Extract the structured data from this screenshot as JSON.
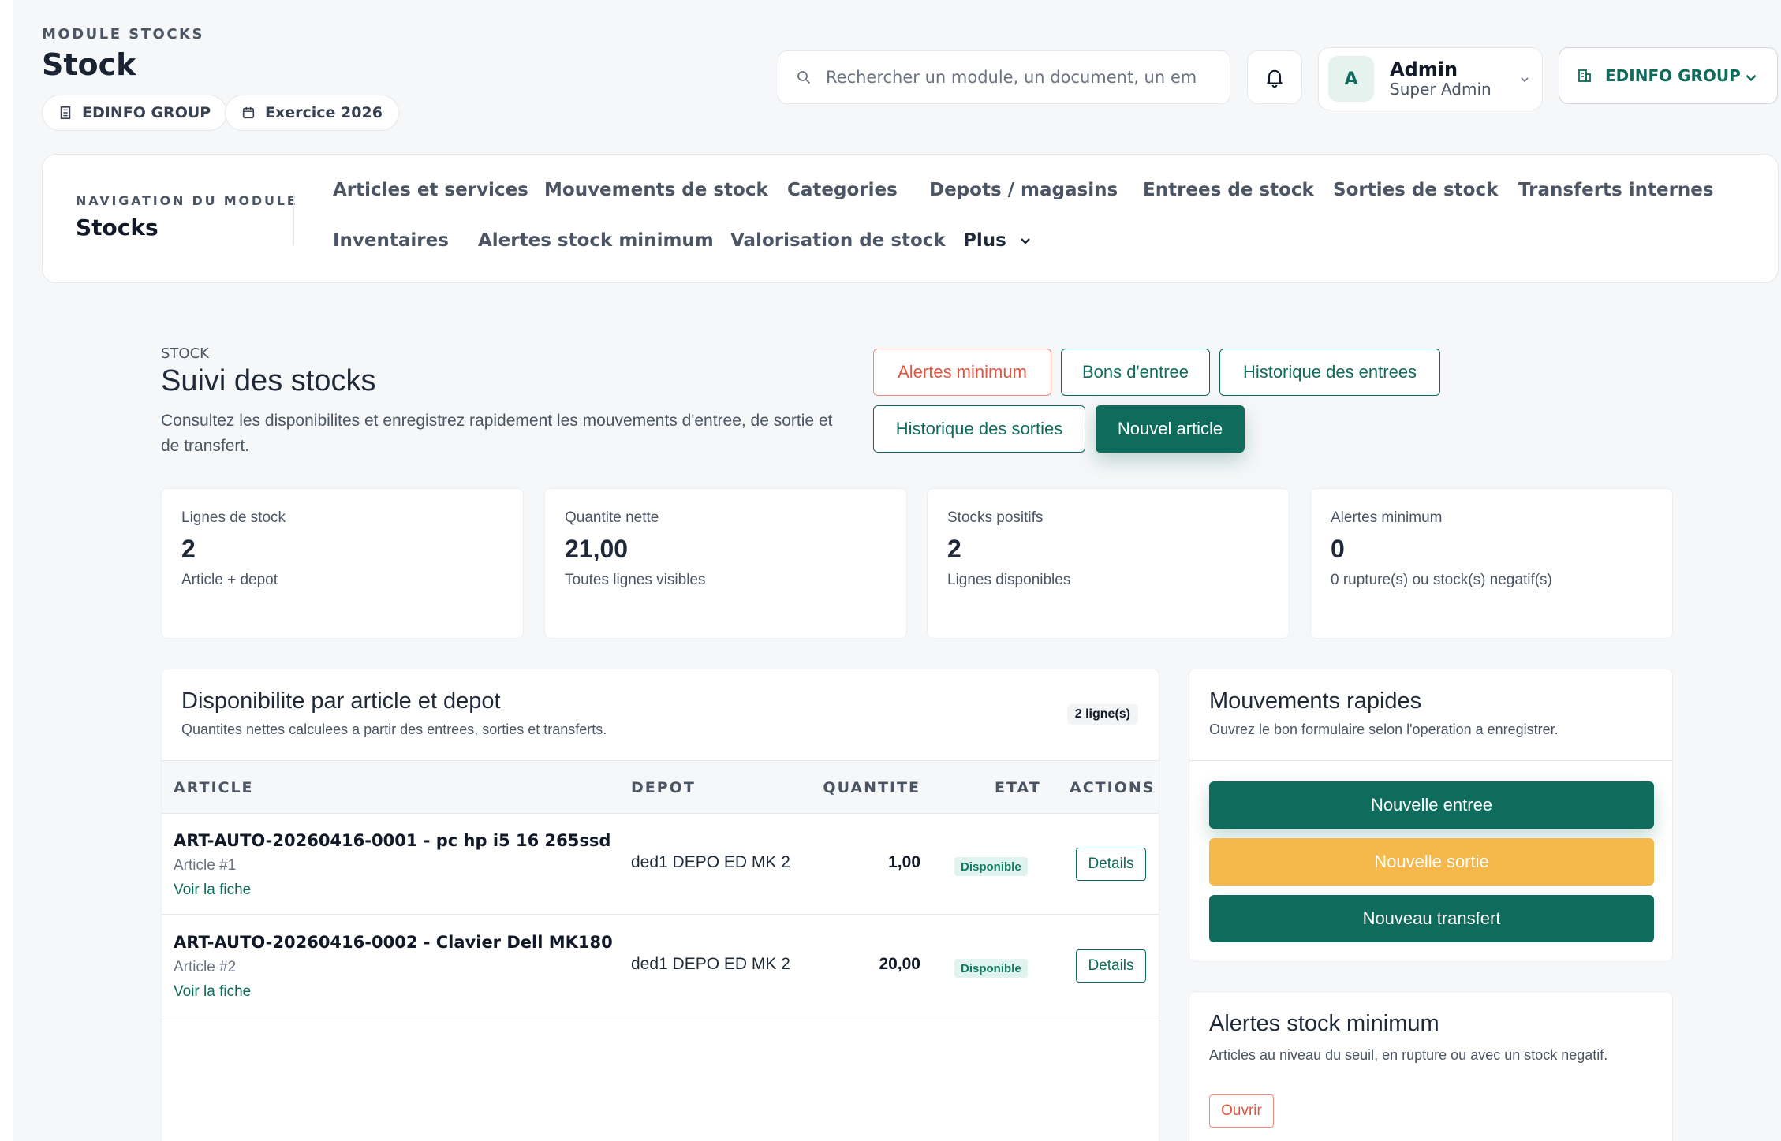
{
  "header": {
    "module_kicker": "MODULE STOCKS",
    "title": "Stock",
    "company_chip": "EDINFO GROUP",
    "year_chip": "Exercice 2026",
    "search_placeholder": "Rechercher un module, un document, un em",
    "user": {
      "initial": "A",
      "name": "Admin",
      "role": "Super Admin"
    },
    "company_selector": "EDINFO GROUP"
  },
  "module_nav": {
    "kicker": "NAVIGATION DU MODULE",
    "title": "Stocks",
    "links": [
      "Articles et services",
      "Mouvements de stock",
      "Categories",
      "Depots / magasins",
      "Entrees de stock",
      "Sorties de stock",
      "Transferts internes",
      "Inventaires",
      "Alertes stock minimum",
      "Valorisation de stock"
    ],
    "more_label": "Plus"
  },
  "content": {
    "crumb": "STOCK",
    "title": "Suivi des stocks",
    "description": "Consultez les disponibilites et enregistrez rapidement les mouvements d'entree, de sortie et de transfert.",
    "actions": {
      "alerts": "Alertes minimum",
      "receipts": "Bons d'entree",
      "entries_history": "Historique des entrees",
      "exits_history": "Historique des sorties",
      "new_article": "Nouvel article"
    }
  },
  "kpis": [
    {
      "label": "Lignes de stock",
      "value": "2",
      "sub": "Article + depot"
    },
    {
      "label": "Quantite nette",
      "value": "21,00",
      "sub": "Toutes lignes visibles"
    },
    {
      "label": "Stocks positifs",
      "value": "2",
      "sub": "Lignes disponibles"
    },
    {
      "label": "Alertes minimum",
      "value": "0",
      "sub": "0 rupture(s) ou stock(s) negatif(s)"
    }
  ],
  "availability": {
    "title": "Disponibilite par article et depot",
    "subtitle": "Quantites nettes calculees a partir des entrees, sorties et transferts.",
    "count": "2 ligne(s)",
    "columns": {
      "article": "ARTICLE",
      "depot": "DEPOT",
      "quantity": "QUANTITE",
      "state": "ETAT",
      "actions": "ACTIONS"
    },
    "rows": [
      {
        "article": "ART-AUTO-20260416-0001 - pc hp i5 16 265ssd",
        "meta": "Article #1",
        "link": "Voir la fiche",
        "depot": "ded1 DEPO ED MK 2",
        "quantity": "1,00",
        "state": "Disponible",
        "action": "Details"
      },
      {
        "article": "ART-AUTO-20260416-0002 - Clavier Dell MK180",
        "meta": "Article #2",
        "link": "Voir la fiche",
        "depot": "ded1 DEPO ED MK 2",
        "quantity": "20,00",
        "state": "Disponible",
        "action": "Details"
      }
    ]
  },
  "quick": {
    "title": "Mouvements rapides",
    "subtitle": "Ouvrez le bon formulaire selon l'operation a enregistrer.",
    "new_entry": "Nouvelle entree",
    "new_exit": "Nouvelle sortie",
    "new_transfer": "Nouveau transfert"
  },
  "alerts_panel": {
    "title": "Alertes stock minimum",
    "subtitle": "Articles au niveau du seuil, en rupture ou avec un stock negatif.",
    "open": "Ouvrir"
  },
  "colors": {
    "brand": "#0f6b5c",
    "danger": "#e2553f",
    "warning": "#f5b84a"
  }
}
